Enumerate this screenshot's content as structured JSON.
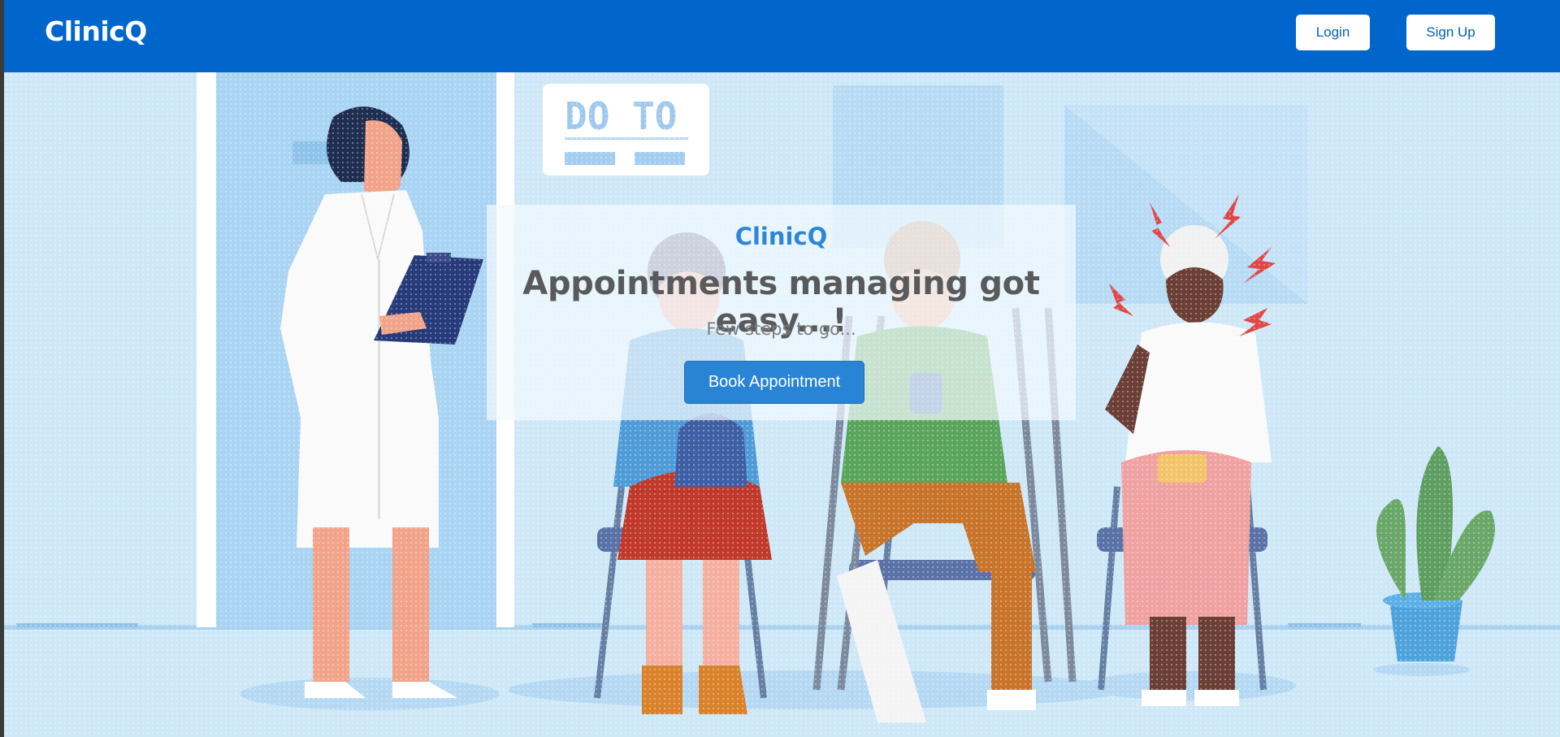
{
  "navbar": {
    "brand": "ClinicQ",
    "login_label": "Login",
    "signup_label": "Sign Up"
  },
  "hero": {
    "board_text": "DO TO",
    "card": {
      "brand": "ClinicQ",
      "title": "Appointments managing got easy...!",
      "subtitle": "Few steps to go...",
      "book_label": "Book Appointment"
    }
  },
  "colors": {
    "navbar": "#0066cc",
    "accent": "#2a84d6",
    "background": "#cfe8f7"
  }
}
